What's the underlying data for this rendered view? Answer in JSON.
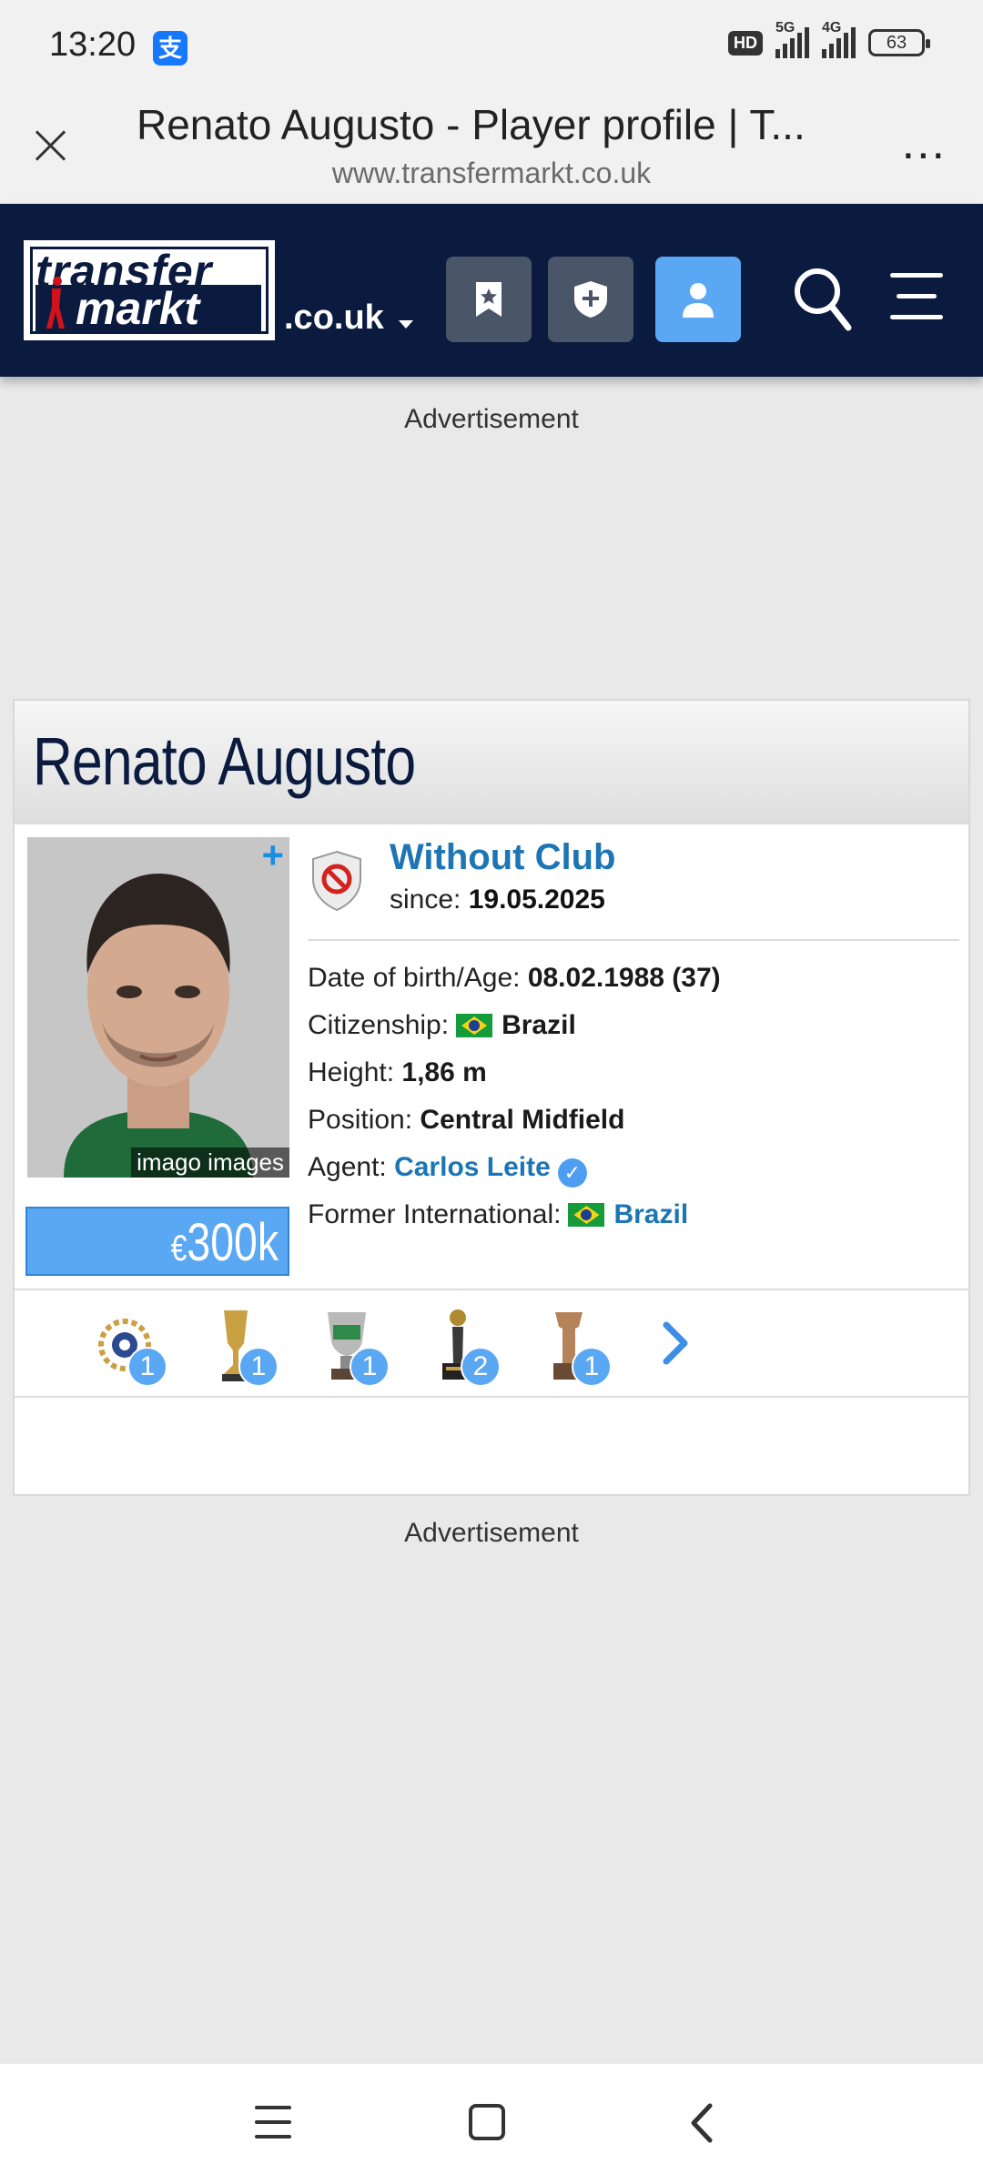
{
  "status": {
    "time": "13:20",
    "app_icon": "支",
    "hd_badge": "HD",
    "net1": "5G",
    "net2": "4G",
    "battery": "63"
  },
  "browser": {
    "title": "Renato Augusto - Player profile | T...",
    "url": "www.transfermarkt.co.uk",
    "more": "..."
  },
  "header": {
    "logo_line1": "transfer",
    "logo_line2": "markt",
    "tld": ".co.uk",
    "icons": [
      "bookmark-star-icon",
      "shield-plus-icon",
      "user-icon",
      "search-icon",
      "menu-icon"
    ]
  },
  "ads": {
    "top": "Advertisement",
    "bottom": "Advertisement"
  },
  "player": {
    "name": "Renato Augusto",
    "photo_credit": "imago images",
    "photo_plus": "+",
    "market_value_currency": "€",
    "market_value": "300k",
    "club": "Without Club",
    "since_label": "since:",
    "since_date": "19.05.2025",
    "dob_label": "Date of birth/Age:",
    "dob_value": "08.02.1988 (37)",
    "citizenship_label": "Citizenship:",
    "citizenship_value": "Brazil",
    "height_label": "Height:",
    "height_value": "1,86 m",
    "position_label": "Position:",
    "position_value": "Central Midfield",
    "agent_label": "Agent:",
    "agent_value": "Carlos Leite",
    "verified_mark": "✓",
    "former_international_label": "Former International:",
    "former_international_value": "Brazil"
  },
  "trophies": [
    {
      "icon": "laurel-award-icon",
      "count": "1"
    },
    {
      "icon": "gold-trophy-icon",
      "count": "1"
    },
    {
      "icon": "cup-trophy-icon",
      "count": "1"
    },
    {
      "icon": "dark-trophy-icon",
      "count": "2"
    },
    {
      "icon": "bronze-trophy-icon",
      "count": "1"
    }
  ],
  "colors": {
    "header_bg": "#0b1b3f",
    "accent": "#5aa7f3",
    "link": "#1d75b3"
  }
}
